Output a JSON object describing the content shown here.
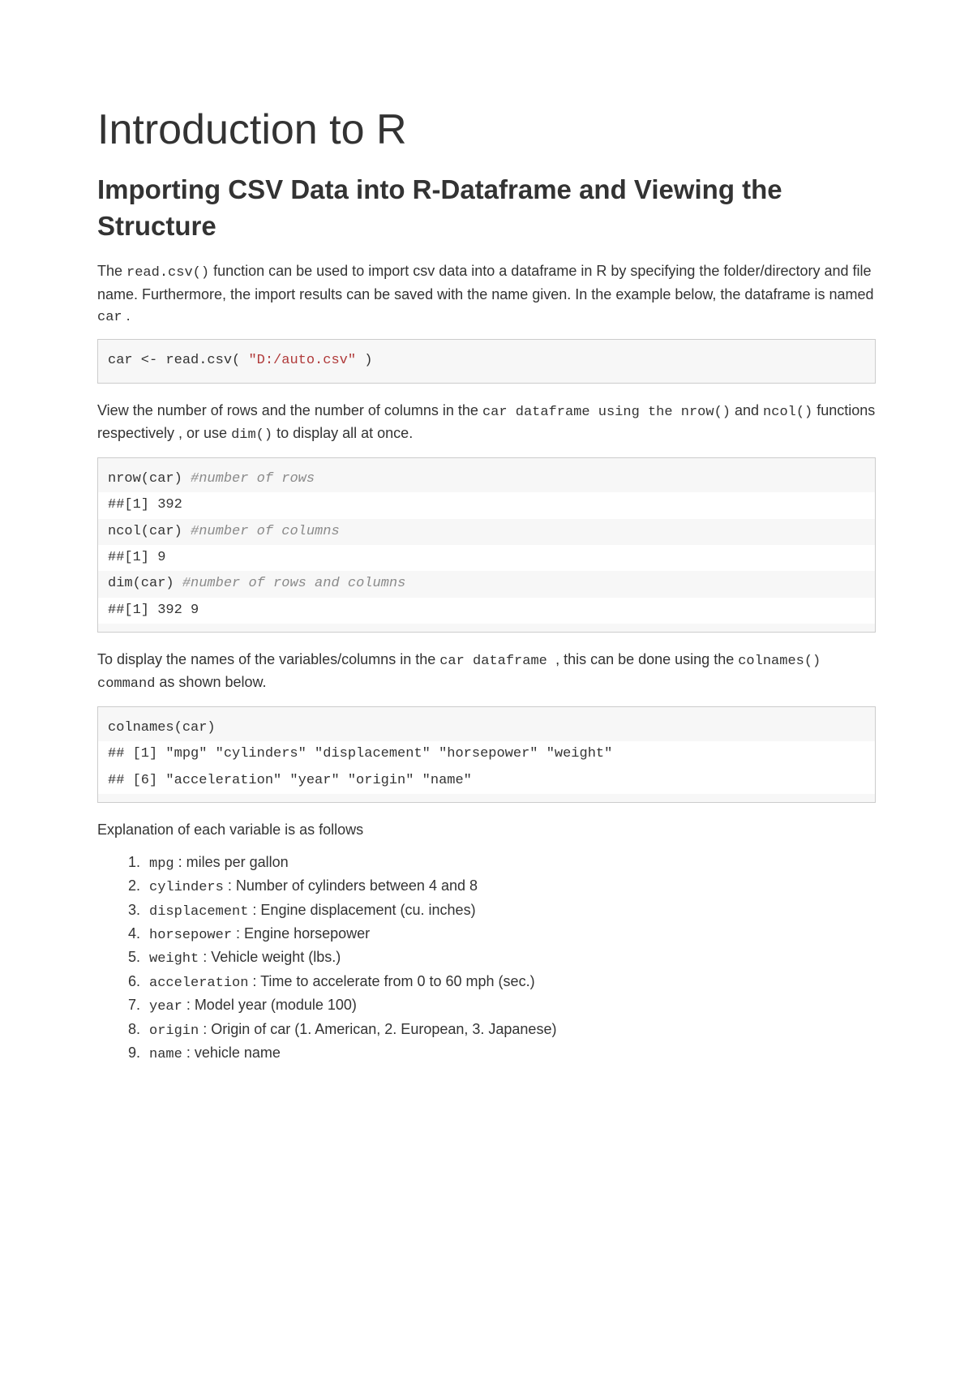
{
  "title": "Introduction to R",
  "subtitle": "Importing CSV Data into R-Dataframe and Viewing the Structure",
  "intro": {
    "t1a": "The ",
    "t1b": "read.csv()",
    "t1c": " function can be used to import csv data into a dataframe in R by specifying the folder/directory and file name. Furthermore, the import results can be saved with the name given. In the example below, the dataframe is named ",
    "t1d": "car",
    "t1e": " ."
  },
  "code1": {
    "pre": "car <- read.csv( ",
    "str": "\"D:/auto.csv\"",
    "post": " )"
  },
  "para2": {
    "a": "View the number of rows and the number of columns in the ",
    "b": "car dataframe using the nrow()",
    "c": " and ",
    "d": "ncol()",
    "e": " functions respectively , or use ",
    "f": "dim()",
    "g": " to display all at once."
  },
  "code2": {
    "l1a": "nrow(car) ",
    "l1c": "#number of rows",
    "l2": "##[1] 392",
    "l3a": "ncol(car) ",
    "l3c": "#number of columns",
    "l4": "##[1] 9",
    "l5a": "dim(car) ",
    "l5c": "#number of rows and columns",
    "l6": "##[1] 392 9"
  },
  "para3": {
    "a": "To display the names of the variables/columns in the ",
    "b": "car dataframe ",
    "c": ", this can be done using the ",
    "d": "colnames() command",
    "e": " as shown below."
  },
  "code3": {
    "l1": "colnames(car)",
    "l2": "## [1] \"mpg\" \"cylinders\" \"displacement\" \"horsepower\" \"weight\"",
    "l3": "## [6] \"acceleration\" \"year\" \"origin\" \"name\""
  },
  "explain_label": "Explanation of each variable is as follows",
  "vars": [
    {
      "name": "mpg",
      "desc": " : miles per gallon"
    },
    {
      "name": "cylinders",
      "desc": " : Number of cylinders between 4 and 8"
    },
    {
      "name": "displacement",
      "desc": " : Engine displacement (cu. inches)"
    },
    {
      "name": "horsepower",
      "desc": " : Engine horsepower"
    },
    {
      "name": "weight",
      "desc": " : Vehicle weight (lbs.)"
    },
    {
      "name": "acceleration",
      "desc": " : Time to accelerate from 0 to 60 mph (sec.)"
    },
    {
      "name": "year",
      "desc": " : Model year (module 100)"
    },
    {
      "name": "origin",
      "desc": " : Origin of car (1. American, 2. European, 3. Japanese)"
    },
    {
      "name": "name",
      "desc": " : vehicle name"
    }
  ]
}
